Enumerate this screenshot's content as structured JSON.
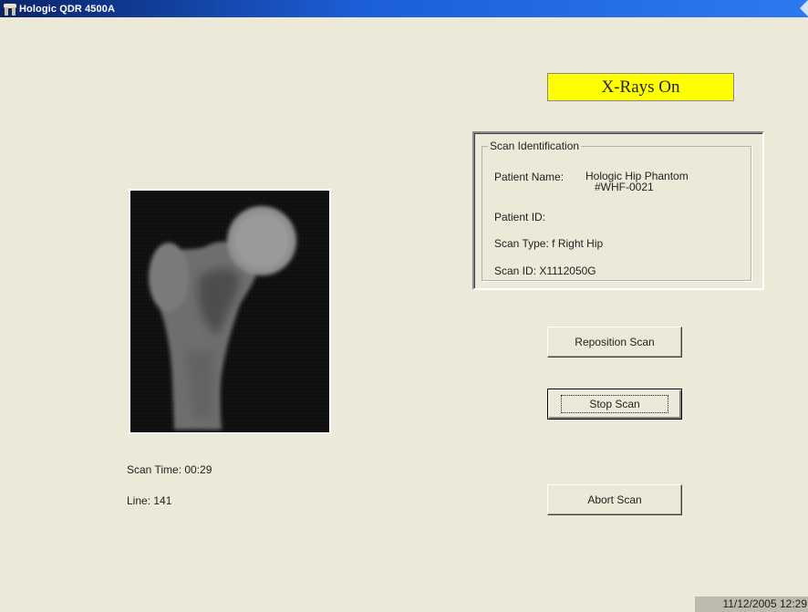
{
  "window": {
    "title": "Hologic QDR 4500A"
  },
  "xray_status": {
    "text": "X-Rays On",
    "color": "#FFFF00"
  },
  "scan_identification": {
    "legend": "Scan Identification",
    "patient_name_label": "Patient Name:",
    "patient_name_line1": "Hologic Hip Phantom",
    "patient_name_line2": "#WHF-0021",
    "patient_id_label": "Patient ID:",
    "patient_id_value": "",
    "scan_type": "Scan Type: f Right Hip",
    "scan_id": "Scan ID: X1112050G"
  },
  "scan_progress": {
    "scan_time": "Scan Time: 00:29",
    "line": "Line: 141"
  },
  "buttons": {
    "reposition": "Reposition Scan",
    "stop": "Stop Scan",
    "abort": "Abort Scan"
  },
  "status_bar": {
    "datetime": "11/12/2005 12:29"
  }
}
